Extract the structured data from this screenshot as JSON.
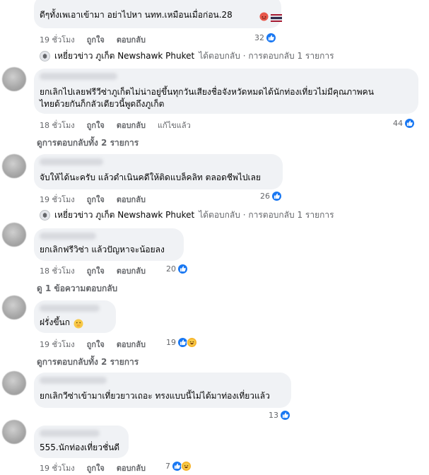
{
  "comments": [
    {
      "text": "ดีๆทั้งเพเอาเข้ามา อย่าไปหา นทท.เหมือนเมื่อก่อน.28",
      "time": "19 ชั่วโมง",
      "like": "ถูกใจ",
      "reply": "ตอบกลับ",
      "edited": "",
      "reactions": "32",
      "page_reply": {
        "page": "เหยี่ยวข่าว ภูเก็ต Newshawk Phuket",
        "rest": "ได้ตอบกลับ · การตอบกลับ 1 รายการ"
      }
    },
    {
      "line1": "ยกเลิกไปเลยฟรีวีซ่าภูเก็ตไม่น่าอยู่ขึ้นทุกวันเสียงชื่อจังหวัดหมดได้นักท่องเที่ยวไม่มีคุณภาพคน",
      "line2": "ไทยด้วยกันก็กลัวเดียวนี้พูดถึงภูเก็ต",
      "time": "18 ชั่วโมง",
      "like": "ถูกใจ",
      "reply": "ตอบกลับ",
      "edited": "แก้ไขแล้ว",
      "reactions": "44",
      "view_replies": "ดูการตอบกลับทั้ง 2 รายการ"
    },
    {
      "text": "จับให้ได้นะครับ แล้วดำเนินคดีให้ติดแบล็คลิท ตลอดชีพไปเลย",
      "time": "19 ชั่วโมง",
      "like": "ถูกใจ",
      "reply": "ตอบกลับ",
      "reactions": "26",
      "page_reply": {
        "page": "เหยี่ยวข่าว ภูเก็ต Newshawk Phuket",
        "rest": "ได้ตอบกลับ · การตอบกลับ 1 รายการ"
      }
    },
    {
      "text": "ยกเลิกฟรีวิซ่า แล้วปัญหาจะน้อยลง",
      "time": "18 ชั่วโมง",
      "like": "ถูกใจ",
      "reply": "ตอบกลับ",
      "reactions": "20",
      "view_replies": "ดู 1 ข้อความตอบกลับ"
    },
    {
      "text": "ฝรั่งขึ้นก",
      "time": "19 ชั่วโมง",
      "like": "ถูกใจ",
      "reply": "ตอบกลับ",
      "reactions": "19",
      "view_replies": "ดูการตอบกลับทั้ง 2 รายการ"
    },
    {
      "text": "ยกเลิกวีซ่าเข้ามาเที่ยวยาวเถอะ ทรงแบบนี้ไม่ได้มาท่องเที่ยวแล้ว",
      "time": "",
      "reactions": "13"
    },
    {
      "text": "555.นักท่องเที่ยวชั่นดี",
      "time": "19 ชั่วโมง",
      "like": "ถูกใจ",
      "reply": "ตอบกลับ",
      "reactions": "7"
    }
  ],
  "colors": {
    "like_blue": "#1877f2",
    "bubble": "#f0f2f5",
    "meta": "#65676b"
  }
}
